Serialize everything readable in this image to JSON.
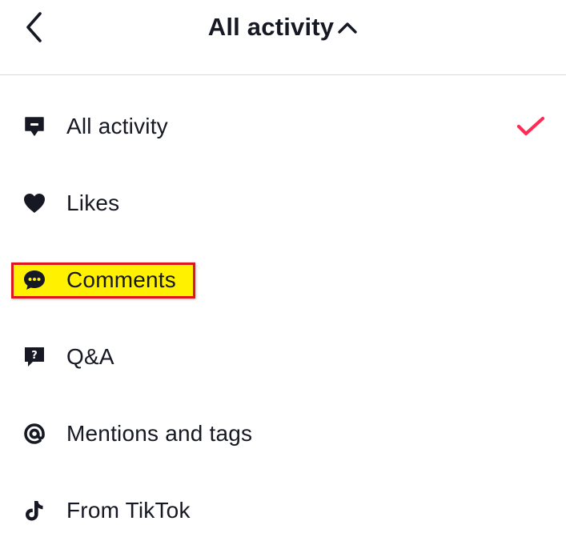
{
  "header": {
    "title": "All activity",
    "back_icon": "chevron-left-icon",
    "caret_icon": "chevron-up-icon"
  },
  "menu": {
    "items": [
      {
        "label": "All activity",
        "icon": "message-square-icon",
        "selected": true
      },
      {
        "label": "Likes",
        "icon": "heart-icon",
        "selected": false
      },
      {
        "label": "Comments",
        "icon": "chat-bubble-icon",
        "selected": false,
        "highlighted": true
      },
      {
        "label": "Q&A",
        "icon": "question-bubble-icon",
        "selected": false
      },
      {
        "label": "Mentions and tags",
        "icon": "at-sign-icon",
        "selected": false
      },
      {
        "label": "From TikTok",
        "icon": "tiktok-logo-icon",
        "selected": false
      }
    ]
  },
  "colors": {
    "text": "#161823",
    "check_accent": "#fe2c55",
    "highlight_fill": "#fff100",
    "highlight_border": "#e0161e",
    "divider": "#d9d9dc"
  }
}
